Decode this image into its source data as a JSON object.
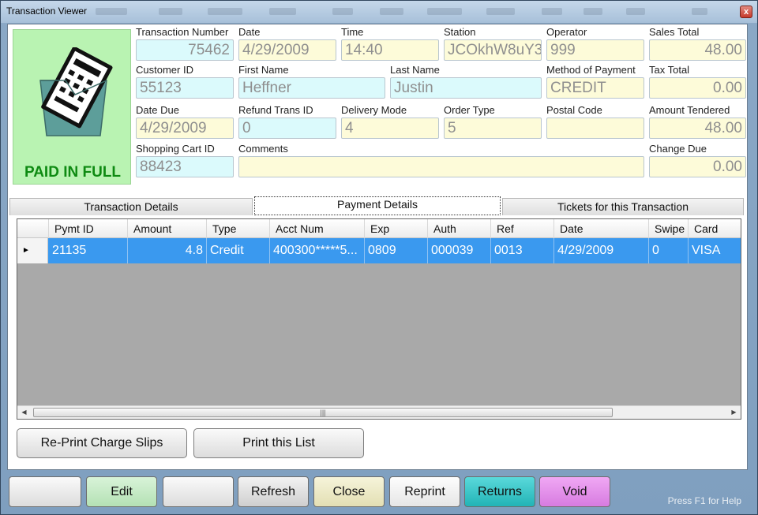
{
  "window": {
    "title": "Transaction Viewer",
    "close_glyph": "x"
  },
  "status": {
    "paid_label": "PAID IN FULL",
    "icon": "receipt-printer-icon"
  },
  "fields": {
    "transaction_number": {
      "label": "Transaction Number",
      "value": "75462"
    },
    "date": {
      "label": "Date",
      "value": "4/29/2009"
    },
    "time": {
      "label": "Time",
      "value": "14:40"
    },
    "station": {
      "label": "Station",
      "value": "JCOkhW8uY3"
    },
    "operator": {
      "label": "Operator",
      "value": "999"
    },
    "sales_total": {
      "label": "Sales Total",
      "value": "48.00"
    },
    "customer_id": {
      "label": "Customer ID",
      "value": "55123"
    },
    "first_name": {
      "label": "First Name",
      "value": "Heffner"
    },
    "last_name": {
      "label": "Last Name",
      "value": "Justin"
    },
    "method_of_payment": {
      "label": "Method of Payment",
      "value": "CREDIT"
    },
    "tax_total": {
      "label": "Tax Total",
      "value": "0.00"
    },
    "date_due": {
      "label": "Date Due",
      "value": "4/29/2009"
    },
    "refund_trans_id": {
      "label": "Refund Trans ID",
      "value": "0"
    },
    "delivery_mode": {
      "label": "Delivery Mode",
      "value": "4"
    },
    "order_type": {
      "label": "Order Type",
      "value": "5"
    },
    "postal_code": {
      "label": "Postal Code",
      "value": ""
    },
    "amount_tendered": {
      "label": "Amount Tendered",
      "value": "48.00"
    },
    "shopping_cart_id": {
      "label": "Shopping Cart ID",
      "value": "88423"
    },
    "comments": {
      "label": "Comments",
      "value": ""
    },
    "change_due": {
      "label": "Change Due",
      "value": "0.00"
    }
  },
  "tabs": [
    {
      "label": "Transaction Details"
    },
    {
      "label": "Payment Details",
      "active": true
    },
    {
      "label": "Tickets for this Transaction"
    }
  ],
  "grid": {
    "columns": [
      "Pymt ID",
      "Amount",
      "Type",
      "Acct Num",
      "Exp",
      "Auth",
      "Ref",
      "Date",
      "Swipe",
      "Card"
    ],
    "rows": [
      [
        "21135",
        "4.8",
        "Credit",
        "400300*****5...",
        "0809",
        "000039",
        "0013",
        "4/29/2009",
        "0",
        "VISA"
      ]
    ],
    "scroll_thumb_glyph": "|||"
  },
  "panel_buttons": {
    "reprint_charge": "Re-Print Charge Slips",
    "print_list": "Print this List"
  },
  "bottom_buttons": {
    "blank1": "",
    "edit": "Edit",
    "blank2": "",
    "refresh": "Refresh",
    "close": "Close",
    "reprint": "Reprint",
    "returns": "Returns",
    "void": "Void"
  },
  "help": "Press F1 for Help",
  "colors": {
    "edit": "#bfe8bf",
    "close": "#eeebc4",
    "returns": "#2ec7c9",
    "void": "#e38ae8",
    "row_selected": "#3a99ef",
    "paid_green": "#0e8a12"
  }
}
